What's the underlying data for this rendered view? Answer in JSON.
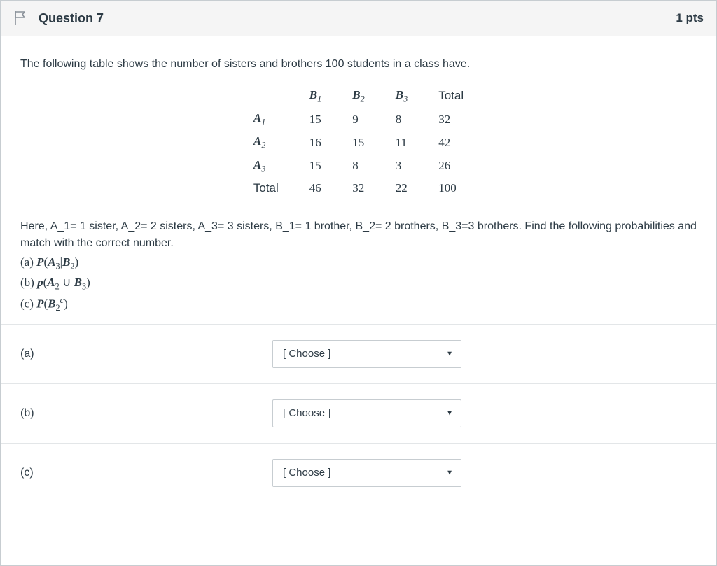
{
  "header": {
    "question_label": "Question 7",
    "points": "1 pts"
  },
  "intro": "The following table shows the number of sisters and brothers 100 students in a class have.",
  "table": {
    "col_headers": [
      "B",
      "B",
      "B",
      "Total"
    ],
    "col_subs": [
      "1",
      "2",
      "3",
      ""
    ],
    "rows": [
      {
        "label": "A",
        "sub": "1",
        "cells": [
          "15",
          "9",
          "8",
          "32"
        ]
      },
      {
        "label": "A",
        "sub": "2",
        "cells": [
          "16",
          "15",
          "11",
          "42"
        ]
      },
      {
        "label": "A",
        "sub": "3",
        "cells": [
          "15",
          "8",
          "3",
          "26"
        ]
      },
      {
        "label": "Total",
        "sub": "",
        "cells": [
          "46",
          "32",
          "22",
          "100"
        ]
      }
    ]
  },
  "explain": "Here, A_1= 1 sister, A_2= 2 sisters, A_3= 3 sisters, B_1= 1 brother, B_2= 2 brothers, B_3=3 brothers.  Find the following probabilities and match with the correct number.",
  "parts": {
    "a_prefix": "(a) ",
    "b_prefix": "(b) ",
    "c_prefix": "(c) "
  },
  "answers": {
    "a_label": "(a)",
    "b_label": "(b)",
    "c_label": "(c)",
    "choose_placeholder": "[ Choose ]"
  }
}
